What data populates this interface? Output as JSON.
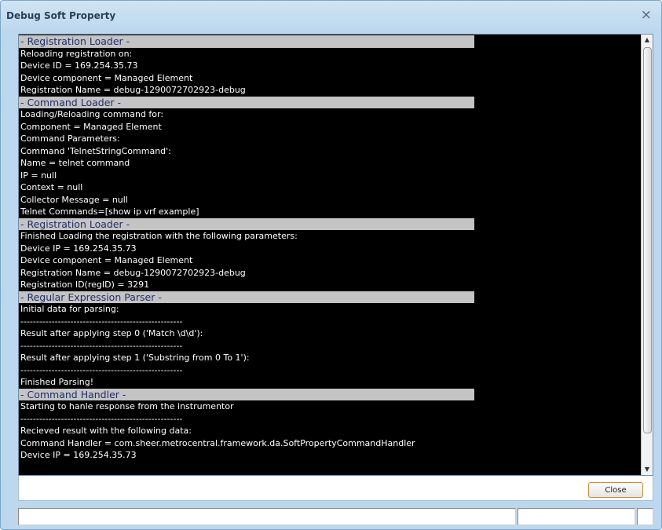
{
  "window": {
    "title": "Debug Soft Property",
    "close_glyph": "×"
  },
  "console": {
    "lines": [
      {
        "header": true,
        "text": "- Registration Loader -"
      },
      {
        "header": false,
        "text": "Reloading registration on:"
      },
      {
        "header": false,
        "text": "Device ID = 169.254.35.73"
      },
      {
        "header": false,
        "text": "Device component = Managed Element"
      },
      {
        "header": false,
        "text": "Registration Name = debug-1290072702923-debug"
      },
      {
        "header": true,
        "text": "- Command Loader -"
      },
      {
        "header": false,
        "text": "Loading/Reloading command for:"
      },
      {
        "header": false,
        "text": "Component = Managed Element"
      },
      {
        "header": false,
        "text": "Command Parameters:"
      },
      {
        "header": false,
        "text": "Command 'TelnetStringCommand':"
      },
      {
        "header": false,
        "text": "Name = telnet command"
      },
      {
        "header": false,
        "text": "IP = null"
      },
      {
        "header": false,
        "text": "Context = null"
      },
      {
        "header": false,
        "text": "Collector Message = null"
      },
      {
        "header": false,
        "text": "Telnet Commands=[show ip vrf example]"
      },
      {
        "header": true,
        "text": "- Registration Loader -"
      },
      {
        "header": false,
        "text": "Finished Loading the registration with the following parameters:"
      },
      {
        "header": false,
        "text": "Device IP = 169.254.35.73"
      },
      {
        "header": false,
        "text": "Device component = Managed Element"
      },
      {
        "header": false,
        "text": "Registration Name = debug-1290072702923-debug"
      },
      {
        "header": false,
        "text": "Registration ID(regID) = 3291"
      },
      {
        "header": true,
        "text": "- Regular Expression Parser -"
      },
      {
        "header": false,
        "text": "Initial data for parsing:"
      },
      {
        "header": false,
        "text": "----------------------------------------------------"
      },
      {
        "header": false,
        "text": "Result after applying step 0 ('Match \\d\\d'):"
      },
      {
        "header": false,
        "text": "----------------------------------------------------"
      },
      {
        "header": false,
        "text": "Result after applying step 1 ('Substring from 0 To 1'):"
      },
      {
        "header": false,
        "text": "----------------------------------------------------"
      },
      {
        "header": false,
        "text": "Finished Parsing!"
      },
      {
        "header": true,
        "text": "- Command Handler -"
      },
      {
        "header": false,
        "text": "Starting to hanle response from the instrumentor"
      },
      {
        "header": false,
        "text": "----------------------------------------------------"
      },
      {
        "header": false,
        "text": "Recieved result with the following data:"
      },
      {
        "header": false,
        "text": "Command Handler = com.sheer.metrocentral.framework.da.SoftPropertyCommandHandler"
      },
      {
        "header": false,
        "text": "Device IP = 169.254.35.73"
      }
    ],
    "scroll_up_glyph": "▲",
    "scroll_down_glyph": "▼"
  },
  "footer": {
    "close_label": "Close"
  }
}
